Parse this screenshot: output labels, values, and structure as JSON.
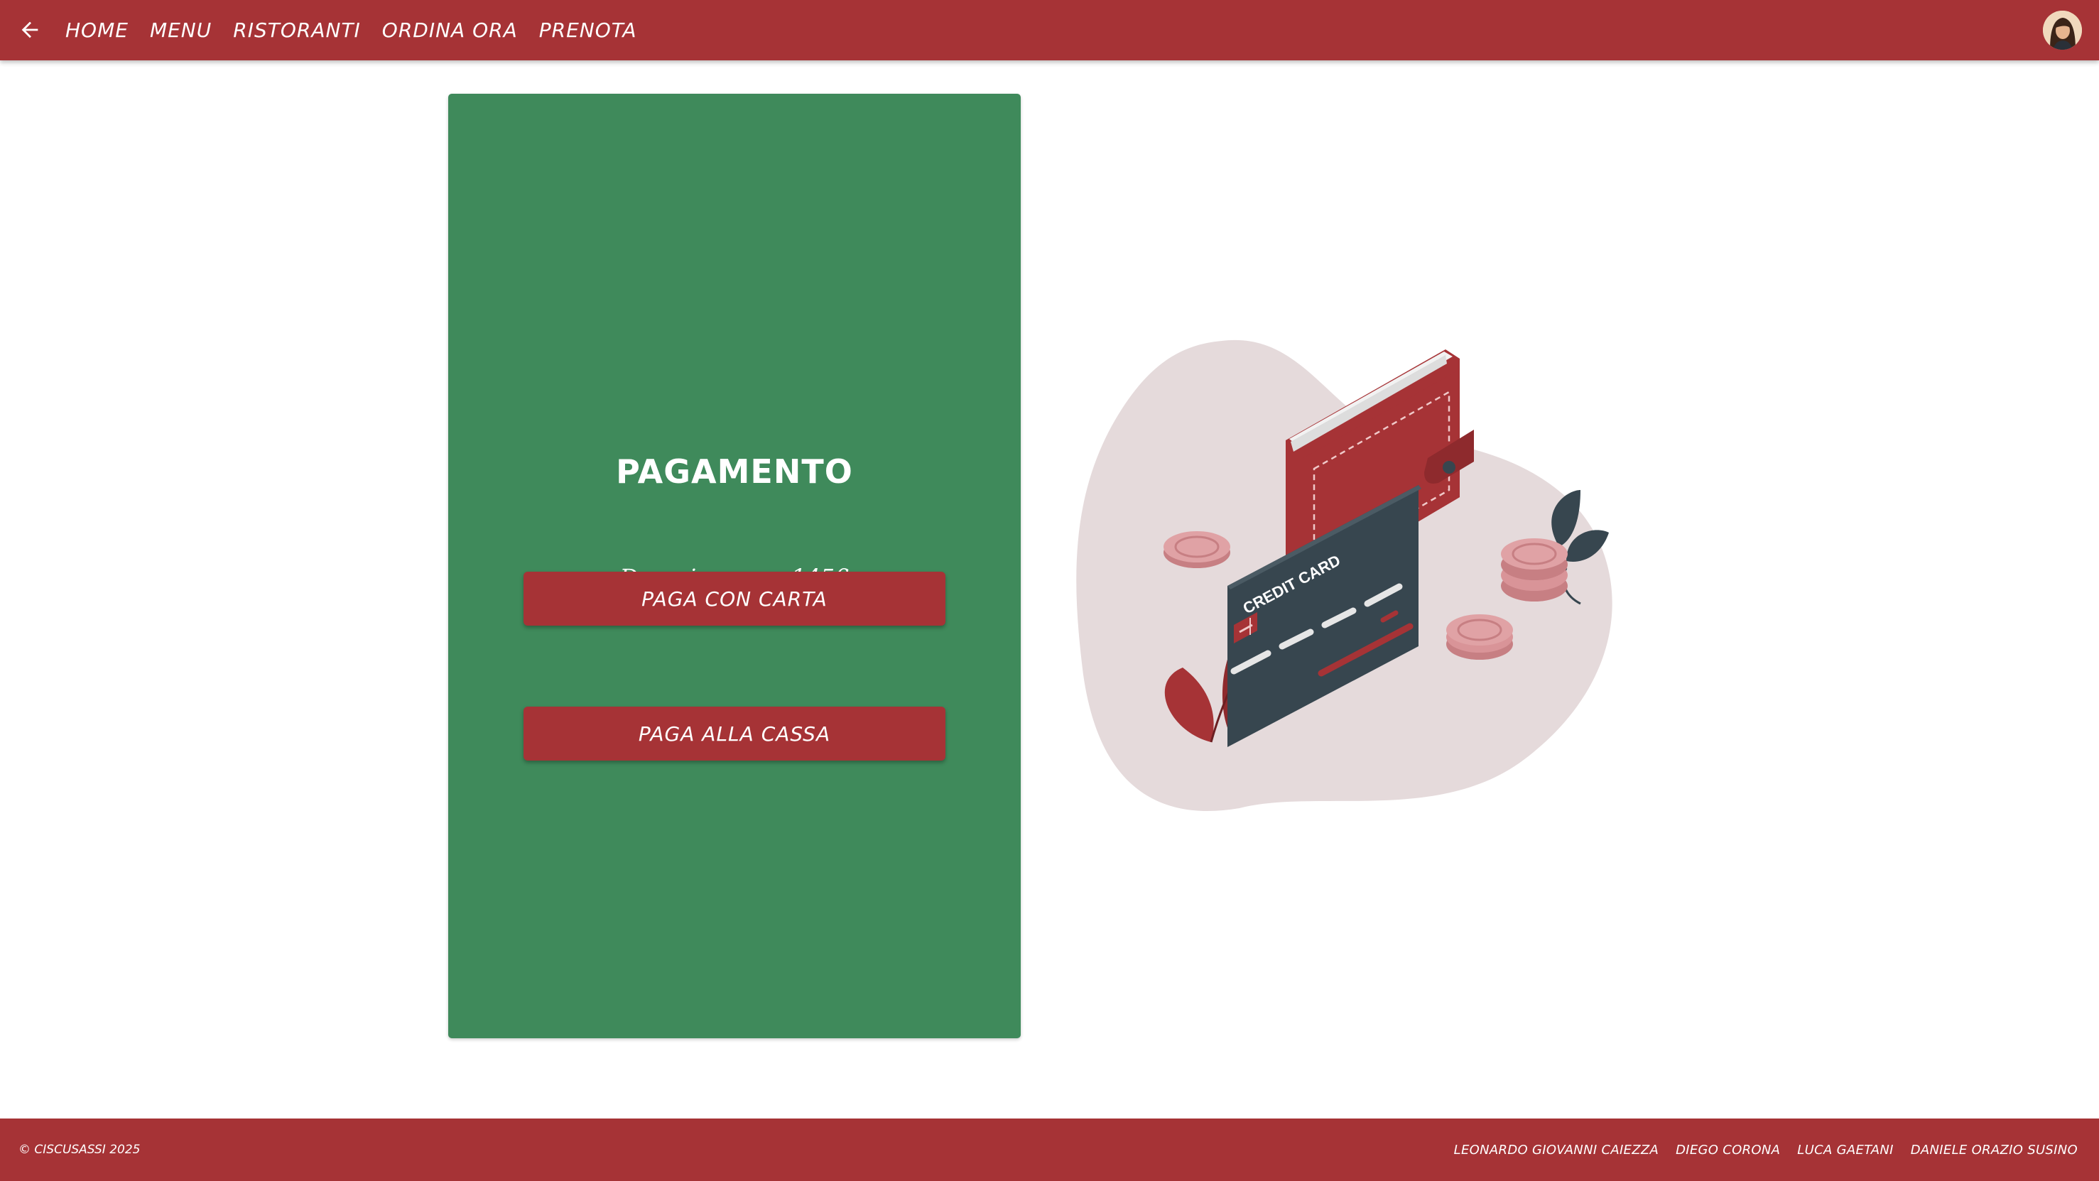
{
  "topbar": {
    "back_icon": "arrow-left-icon",
    "nav": [
      {
        "label": "HOME"
      },
      {
        "label": "MENU"
      },
      {
        "label": "RISTORANTI"
      },
      {
        "label": "ORDINA ORA"
      },
      {
        "label": "PRENOTA"
      }
    ],
    "avatar_icon": "user-avatar"
  },
  "payment": {
    "title": "PAGAMENTO",
    "subtitle": "Dovrai pagare 145€",
    "card_button": "PAGA CON CARTA",
    "cash_button": "PAGA ALLA CASSA"
  },
  "illustration": {
    "card_text": "CREDIT CARD"
  },
  "footer": {
    "copyright": "© CISCUSASSI 2025",
    "authors": [
      "LEONARDO GIOVANNI CAIEZZA",
      "DIEGO CORONA",
      "LUCA GAETANI",
      "DANIELE ORAZIO SUSINO"
    ]
  },
  "colors": {
    "brand_red": "#a63336",
    "card_green": "#3f8a5b",
    "blob": "#e5dadb",
    "dark_slate": "#37464f"
  }
}
